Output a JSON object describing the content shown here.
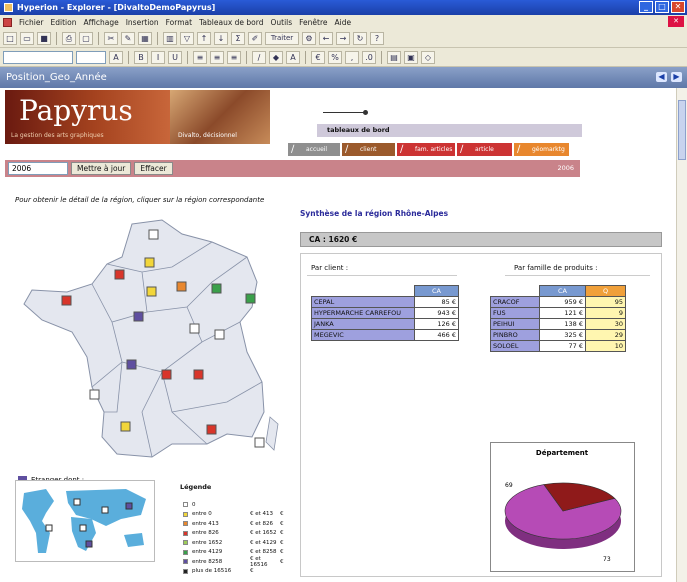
{
  "window": {
    "title": "Hyperion - Explorer - [DivaltoDemoPapyrus]"
  },
  "menu": [
    "Fichier",
    "Edition",
    "Affichage",
    "Insertion",
    "Format",
    "Tableaux de bord",
    "Outils",
    "Fenêtre",
    "Aide"
  ],
  "toolbar": {
    "traiter_label": "Traiter"
  },
  "document": {
    "title": "Position_Geo_Année"
  },
  "banner": {
    "brand": "Papyrus",
    "tagline": "La gestion des arts graphiques",
    "divalto": "Divalto, décisionnel",
    "section": "tableaux de bord"
  },
  "tabs": [
    "accueil",
    "client",
    "fam. articles",
    "article",
    "géomarktg"
  ],
  "controls": {
    "year_value": "2006",
    "update_label": "Mettre à jour",
    "clear_label": "Effacer",
    "year_label": "2006"
  },
  "instruction": "Pour obtenir le détail de la région, cliquer sur la région correspondante",
  "region_title": "Synthèse de la région Rhône-Alpes",
  "ca_total": "CA : 1620     €",
  "by_client_label": "Par client :",
  "by_family_label": "Par famille de produits :",
  "clients": {
    "header": "CA",
    "rows": [
      {
        "name": "CEPAL",
        "ca": "85 €"
      },
      {
        "name": "HYPERMARCHE CARREFOU",
        "ca": "943 €"
      },
      {
        "name": "JANKA",
        "ca": "126 €"
      },
      {
        "name": "MEGEVIC",
        "ca": "466 €"
      }
    ]
  },
  "families": {
    "header_ca": "CA",
    "header_q": "Q",
    "rows": [
      {
        "name": "CRACOF",
        "ca": "959 €",
        "q": "95"
      },
      {
        "name": "FUS",
        "ca": "121 €",
        "q": "9"
      },
      {
        "name": "PEIHUI",
        "ca": "138 €",
        "q": "30"
      },
      {
        "name": "PINBRO",
        "ca": "325 €",
        "q": "29"
      },
      {
        "name": "SOLOEL",
        "ca": "77 €",
        "q": "10"
      }
    ]
  },
  "stranger_label": "Etranger dont :",
  "legend": {
    "title": "Légende",
    "rows": [
      {
        "range": "0",
        "low": "",
        "high": "",
        "color": "#ffffff"
      },
      {
        "range": "entre 0",
        "low": "€ et 413",
        "high": "€",
        "color": "#f2d63a"
      },
      {
        "range": "entre 413",
        "low": "€ et 826",
        "high": "€",
        "color": "#e8872e"
      },
      {
        "range": "entre 826",
        "low": "€ et 1652",
        "high": "€",
        "color": "#d8352a"
      },
      {
        "range": "entre 1652",
        "low": "€ et 4129",
        "high": "€",
        "color": "#9ccc58"
      },
      {
        "range": "entre 4129",
        "low": "€ et 8258",
        "high": "€",
        "color": "#3aa04a"
      },
      {
        "range": "entre 8258",
        "low": "€ et 16516",
        "high": "€",
        "color": "#5f4fa0"
      },
      {
        "range": "plus de 16516",
        "low": "€",
        "high": "",
        "color": "#222222"
      }
    ]
  },
  "chart_data": {
    "type": "pie",
    "title": "Département",
    "labels": [
      "69",
      "73"
    ],
    "values": [
      1250,
      370
    ],
    "colors": [
      "#b64bb6",
      "#8f1a1a"
    ]
  }
}
